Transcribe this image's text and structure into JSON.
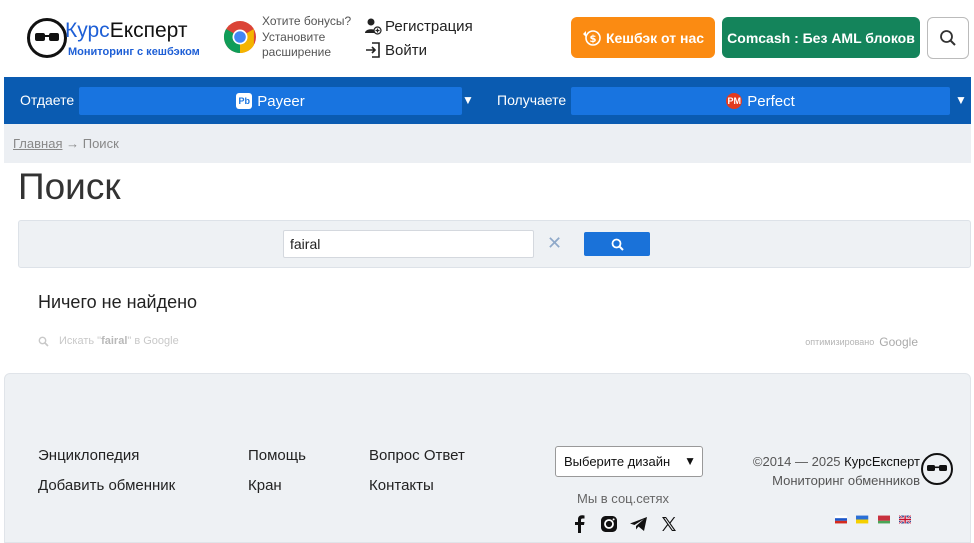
{
  "header": {
    "logo": {
      "title_part1": "Курс",
      "title_part2": "Експерт",
      "subtitle": "Мониторинг с кешбэком"
    },
    "extension": {
      "line1": "Хотите бонусы?",
      "line2": "Установите",
      "line3": "расширение"
    },
    "auth": {
      "register": "Регистрация",
      "login": "Войти"
    },
    "cashback_button": "Кешбэк от нас",
    "comcash_button": "Comcash : Без AML блоков"
  },
  "exchange": {
    "give_label": "Отдаете",
    "give_currency": "Payeer",
    "give_icon_text": "Pb",
    "receive_label": "Получаете",
    "receive_currency": "Perfect",
    "receive_icon_text": "PM"
  },
  "breadcrumb": {
    "home": "Главная",
    "separator": "→",
    "current": "Поиск"
  },
  "page_title": "Поиск",
  "search": {
    "value": "fairal",
    "clear_icon": "✕"
  },
  "results": {
    "no_results": "Ничего не найдено",
    "google_prefix": "Искать \"",
    "google_query": "fairal",
    "google_suffix": "\" в Google",
    "optimized_label": "оптимизировано",
    "google_brand": "Google"
  },
  "footer": {
    "links": {
      "encyclopedia": "Энциклопедия",
      "add_exchanger": "Добавить обменник",
      "help": "Помощь",
      "faucet": "Кран",
      "faq": "Вопрос Ответ",
      "contacts": "Контакты"
    },
    "design_select": "Выберите дизайн",
    "social_label": "Мы в соц.сетях",
    "copyright_prefix": "©2014 — 2025 ",
    "copyright_brand": "КурсЕксперт",
    "copyright_sub": "Мониторинг обменников"
  },
  "colors": {
    "brand_blue": "#1e5fd6",
    "bar_blue": "#0a5bb1",
    "select_blue": "#1874e0",
    "cashback_orange": "#fb8b12",
    "comcash_green": "#14845b"
  }
}
